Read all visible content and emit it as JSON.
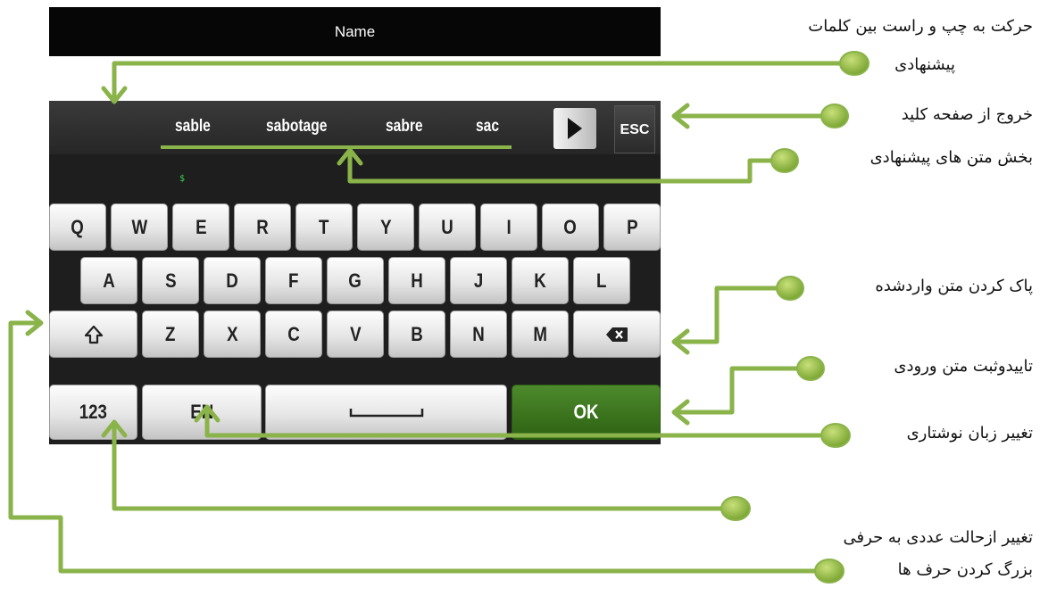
{
  "device": {
    "title": "Name",
    "suggestions": [
      "sable",
      "sabotage",
      "sabre",
      "sac"
    ],
    "esc_label": "ESC",
    "cursor_char": "$",
    "keyboard": {
      "row1": [
        "Q",
        "W",
        "E",
        "R",
        "T",
        "Y",
        "U",
        "I",
        "O",
        "P"
      ],
      "row2": [
        "A",
        "S",
        "D",
        "F",
        "G",
        "H",
        "J",
        "K",
        "L"
      ],
      "row3": [
        "Z",
        "X",
        "C",
        "V",
        "B",
        "N",
        "M"
      ],
      "numeric_label": "123",
      "language_label": "EN",
      "ok_label": "OK",
      "shift_icon": "shift-arrow-icon",
      "backspace_icon": "backspace-icon",
      "space_icon": "space-bar-icon"
    },
    "colors": {
      "ok_button": "#3f7a22",
      "annotation": "#8ab34a"
    }
  },
  "annotations": {
    "move_suggestions_line1": "حرکت به چپ و راست بین کلمات",
    "move_suggestions_line2": "پیشنهادی",
    "exit_keyboard": "خروج از صفحه کلید",
    "suggestion_area": "بخش متن های پیشنهادی",
    "clear_text": "پاک کردن متن واردشده",
    "confirm_text": "تاییدوثبت متن ورودی",
    "change_language": "تغییر زبان نوشتاری",
    "numeric_to_alpha": "تغییر ازحالت عددی به حرفی",
    "capitalize": "بزرگ کردن حرف ها"
  }
}
